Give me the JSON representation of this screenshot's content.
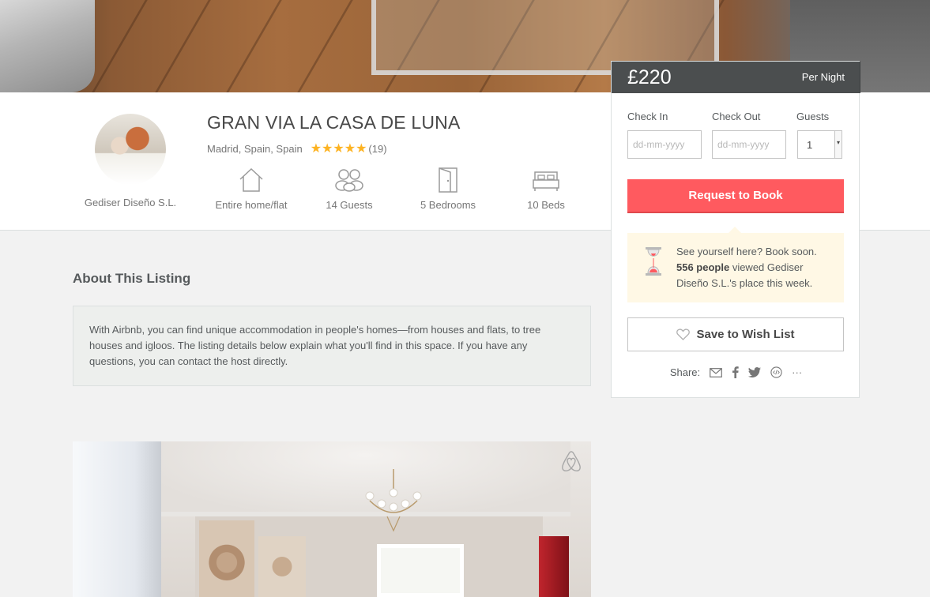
{
  "listing": {
    "title": "GRAN VIA LA CASA DE LUNA",
    "location": "Madrid, Spain, Spain",
    "rating_stars": 5,
    "review_count": "(19)"
  },
  "host": {
    "name": "Gediser Diseño S.L."
  },
  "features": [
    {
      "icon": "house-icon",
      "label": "Entire home/flat"
    },
    {
      "icon": "guests-icon",
      "label": "14 Guests"
    },
    {
      "icon": "door-icon",
      "label": "5 Bedrooms"
    },
    {
      "icon": "bed-icon",
      "label": "10 Beds"
    }
  ],
  "booking": {
    "price": "£220",
    "per_night": "Per Night",
    "check_in_label": "Check In",
    "check_out_label": "Check Out",
    "guests_label": "Guests",
    "check_in_placeholder": "dd-mm-yyyy",
    "check_out_placeholder": "dd-mm-yyyy",
    "guests_value": "1",
    "request_button": "Request to Book",
    "notice_line1": "See yourself here? Book soon.",
    "notice_count": "556 people",
    "notice_rest": " viewed Gediser Diseño S.L.'s place this week.",
    "wish_button": "Save to Wish List",
    "share_label": "Share:",
    "share_more": "···"
  },
  "about": {
    "title": "About This Listing",
    "text": "With Airbnb, you can find unique accommodation in people's homes—from houses and flats, to tree houses and igloos. The listing details below explain what you'll find in this space. If you have any questions, you can contact the host directly."
  },
  "colors": {
    "brand": "#ff5a5f",
    "star": "#fdb322",
    "notice_bg": "#fff8e5"
  }
}
